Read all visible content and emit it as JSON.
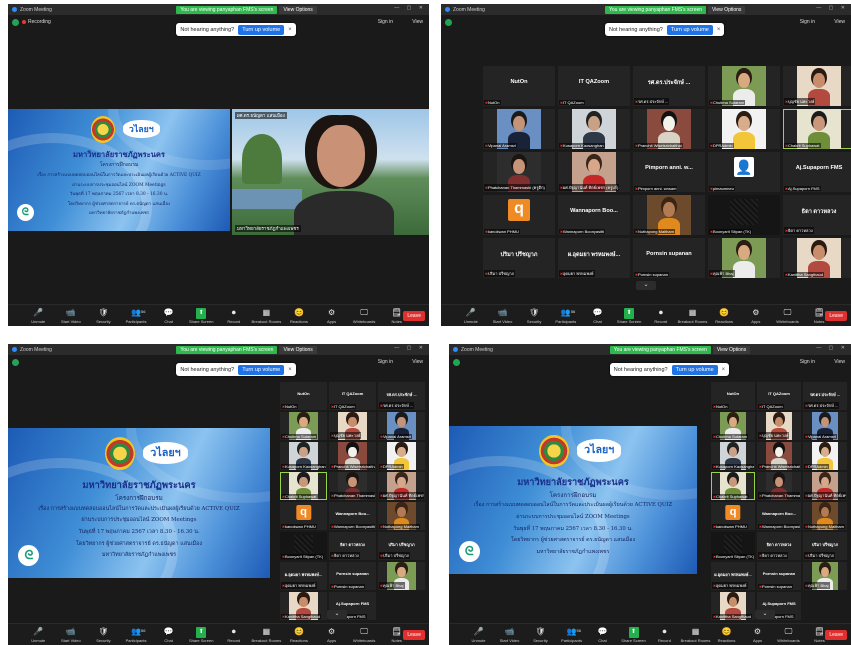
{
  "top_bar": {
    "share_message": "You are viewing panyaphan FMS's screen",
    "view_options": "View Options",
    "window_title": "Zoom Meeting"
  },
  "status": {
    "recording": "Recording",
    "sign_in": "Sign in",
    "view": "View"
  },
  "toast": {
    "text": "Not hearing anything?",
    "button": "Turn up volume"
  },
  "toolbar": {
    "items": [
      "Unmute",
      "Start Video",
      "Security",
      "Participants",
      "Chat",
      "Share Screen",
      "Record",
      "Breakout Rooms",
      "Reactions",
      "Apps",
      "Whiteboards",
      "Notes"
    ],
    "participants_count": "56",
    "leave": "Leave"
  },
  "slide": {
    "logo_text": "วไลยฯ",
    "university": "มหาวิทยาลัยราชภัฏพระนคร",
    "project": "โครงการฝึกอบรม",
    "lines": [
      "เรื่อง การสร้างแบบทดสอบออนไลน์ในการวัดและประเมินผลผู้เรียนด้วย ACTIVE QUIZ",
      "ผ่านระบบการประชุมออนไลน์ ZOOM Meetings",
      "วันพุธที่ 17 พฤษภาคม 2567 เวลา 8.30 - 16.30 น.",
      "โดยวิทยากร ผู้ช่วยศาสตราจารย์ ดร.ธนัญดา แสนเมือง",
      "มหาวิทยาลัยราชภัฏกำแพงเพชร"
    ]
  },
  "speaker": {
    "name": "ผศ.ดร.ธนัญดา แสนเมือง",
    "caption": "มหาวิทยาลัยราชภัฏกำแพงเพชร"
  },
  "gallery": [
    {
      "big": "NutOn",
      "name": "NutOn"
    },
    {
      "big": "IT QAZoom",
      "name": "IT QAZoom"
    },
    {
      "big": "รศ.ดร.ประจักษ์ ...",
      "name": "รศ.ดร.ประจักษ์ ..."
    },
    {
      "name": "Chutima Sutaram",
      "photo": "woman-glasses"
    },
    {
      "name": "บุญชัย นพะวงษ์",
      "photo": "woman"
    },
    {
      "name": "Vipanai Aramsri",
      "photo": "man-suit"
    },
    {
      "name": "Kusaporn Kaosanghan",
      "photo": "man"
    },
    {
      "name": "Pranchit Wisetsrichaithai",
      "photo": "geisha"
    },
    {
      "name": "DPRAdmin",
      "photo": "woman-yellow"
    },
    {
      "name": "Chakrit Suphawat",
      "photo": "man-green",
      "speaking": true
    },
    {
      "name": "Phatchanan Thammasiri (ครูติก)",
      "photo": "woman-dark"
    },
    {
      "name": "ผศ.ปัฐญานันท์ ทิตย์เพชร (ครูบร์)",
      "photo": "woman-red"
    },
    {
      "big": "Pimporn anni. w...",
      "name": "Pimporn anni. wnsam"
    },
    {
      "name": "pimaumneu",
      "photo": "avatar"
    },
    {
      "big": "Aj.Supaporn FMS",
      "name": "Aj.Supaporn FMS"
    },
    {
      "name": "kanokwan PHMU",
      "photo": "orange-q"
    },
    {
      "big": "Wannaporn Boo...",
      "name": "Wannaporn Boonyasitti"
    },
    {
      "name": "Nuthapong Maitham",
      "photo": "monk"
    },
    {
      "name": "Boonyarit Sitpan (TK)",
      "photo": "dark"
    },
    {
      "big": "ธิดา ดาวหลวง",
      "name": "ธิดา ดาวหลวง"
    },
    {
      "big": "ปริมา ปรีชญาภ",
      "name": "ปริมา ปรีชญาภ"
    },
    {
      "big": "ผ.อุดมยา พรหมพงษ์...",
      "name": "อุดมยา พรหมพงษ์"
    },
    {
      "big": "Pornsin supanan",
      "name": "Pornsin supanan"
    },
    {
      "name": "คุณฟ้า Bhaj",
      "photo": "woman-glasses"
    },
    {
      "name": "Kanittha Sangthaud",
      "photo": "woman"
    }
  ]
}
